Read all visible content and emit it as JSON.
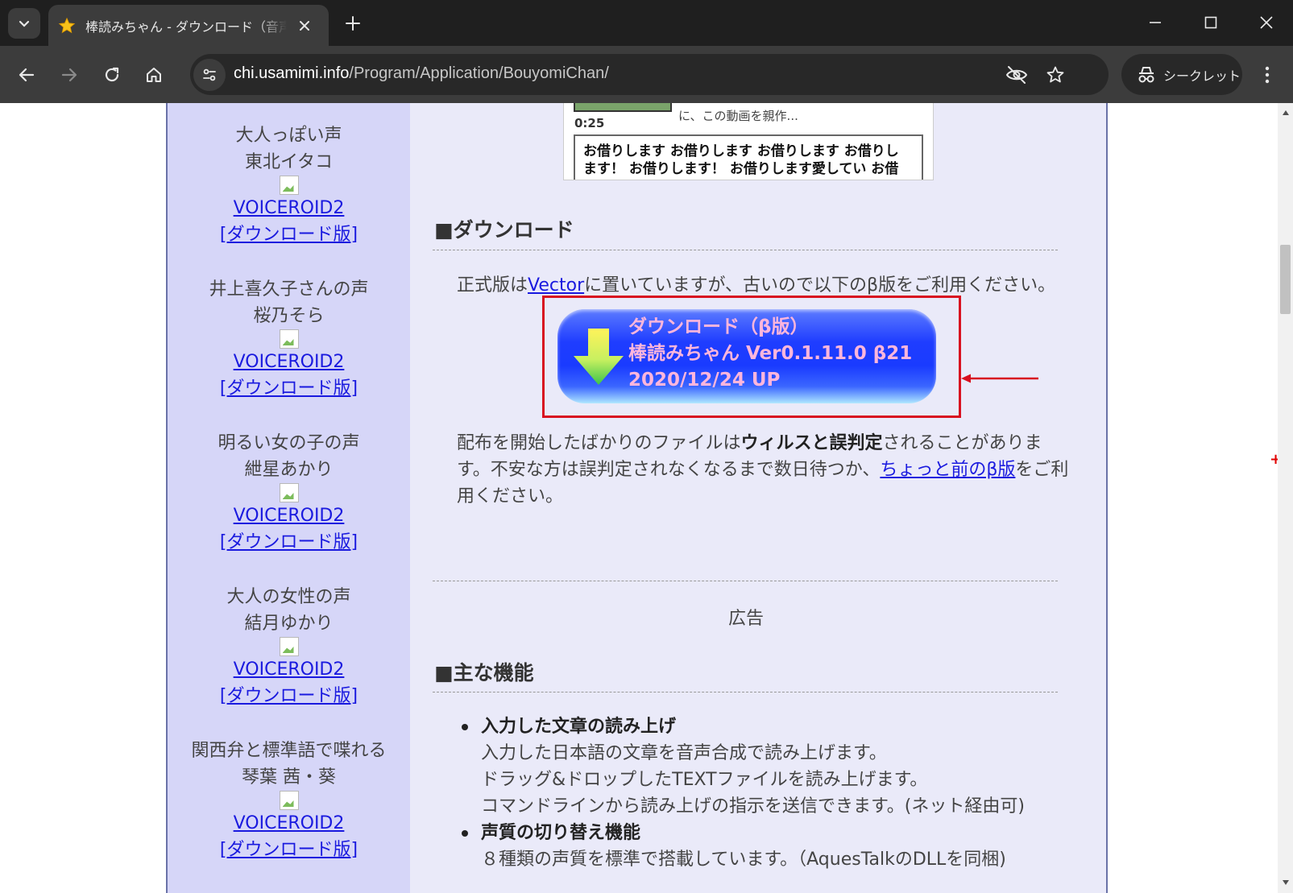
{
  "browser": {
    "tab_title": "棒読みちゃん - ダウンロード（音声合成",
    "url_host": "chi.usamimi.info",
    "url_path": "/Program/Application/BouyomiChan/",
    "incognito_label": "シークレット"
  },
  "sidebar": {
    "voices": [
      {
        "desc": "大人っぽい声",
        "name": "東北イタコ",
        "link": "VOICEROID2",
        "sub_link": "[ダウンロード版]"
      },
      {
        "desc": "井上喜久子さんの声",
        "name": "桜乃そら",
        "link": "VOICEROID2",
        "sub_link": "[ダウンロード版]"
      },
      {
        "desc": "明るい女の子の声",
        "name": "紲星あかり",
        "link": "VOICEROID2",
        "sub_link": "[ダウンロード版]"
      },
      {
        "desc": "大人の女性の声",
        "name": "結月ゆかり",
        "link": "VOICEROID2",
        "sub_link": "[ダウンロード版]"
      },
      {
        "desc": "関西弁と標準語で喋れる",
        "name": "琴葉 茜・葵",
        "link": "VOICEROID2",
        "sub_link": "[ダウンロード版]"
      }
    ]
  },
  "embed": {
    "time": "0:25",
    "desc": "に、この動画を親作...",
    "comment_line1": "お借りします お借りします お借りします お借りし",
    "comment_line2": "ます！ お借りします！ お借りします愛してい お借"
  },
  "download": {
    "title": "■ダウンロード",
    "intro_before": "正式版は",
    "intro_link": "Vector",
    "intro_after": "に置いていますが、古いので以下のβ版をご利用ください。",
    "button_line1": "ダウンロード（β版）",
    "button_line2": "棒読みちゃん Ver0.1.11.0 β21",
    "button_line3": "2020/12/24 UP",
    "note_1": "配布を開始したばかりのファイルは",
    "note_bold": "ウィルスと誤判定",
    "note_2": "されることがありま",
    "note_3": "す。不安な方は誤判定されなくなるまで数日待つか、",
    "note_link": "ちょっと前のβ版",
    "note_4": "をご利",
    "note_5": "用ください。"
  },
  "ad_label": "広告",
  "features": {
    "title": "■主な機能",
    "items": [
      {
        "head": "入力した文章の読み上げ",
        "lines": [
          "入力した日本語の文章を音声合成で読み上げます。",
          "ドラッグ&ドロップしたTEXTファイルを読み上げます。",
          "コマンドラインから読み上げの指示を送信できます。(ネット経由可)"
        ]
      },
      {
        "head": "声質の切り替え機能",
        "lines": [
          "８種類の声質を標準で搭載しています。（AquesTalkのDLLを同梱)"
        ]
      }
    ]
  },
  "colors": {
    "accent_red": "#d81020",
    "link": "#1a1adf",
    "sidebar_bg": "#d6d6f8",
    "button_text": "#ffb6dc"
  }
}
